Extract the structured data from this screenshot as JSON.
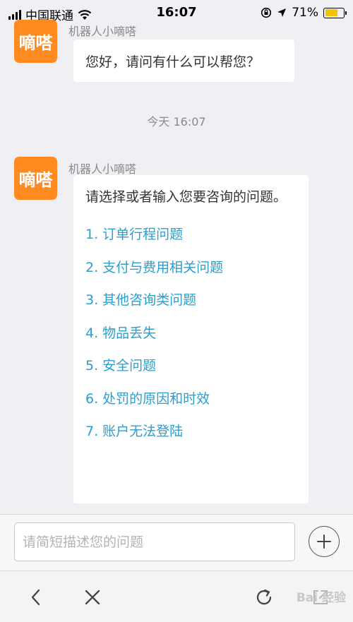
{
  "status_bar": {
    "carrier": "中国联通",
    "time": "16:07",
    "battery_percent": "71%",
    "battery_level": 0.71,
    "battery_color": "#f5c400"
  },
  "chat": {
    "avatar_text": "嘀嗒",
    "avatar_color": "#ff8a1f",
    "sender_name": "机器人小嘀嗒",
    "message_1": "您好，请问有什么可以帮您？",
    "timestamp": "今天 16:07",
    "message_2_prompt": "请选择或者输入您要咨询的问题。",
    "options": [
      "1. 订单行程问题",
      "2. 支付与费用相关问题",
      "3. 其他咨询类问题",
      "4. 物品丢失",
      "5. 安全问题",
      "6. 处罚的原因和时效",
      "7. 账户无法登陆"
    ],
    "option_color": "#2a9fd0"
  },
  "composer": {
    "placeholder": "请简短描述您的问题",
    "value": ""
  },
  "toolbar": {
    "icons": [
      "back-icon",
      "close-icon",
      "reload-icon",
      "share-icon"
    ],
    "watermark": "Bai 经验"
  }
}
